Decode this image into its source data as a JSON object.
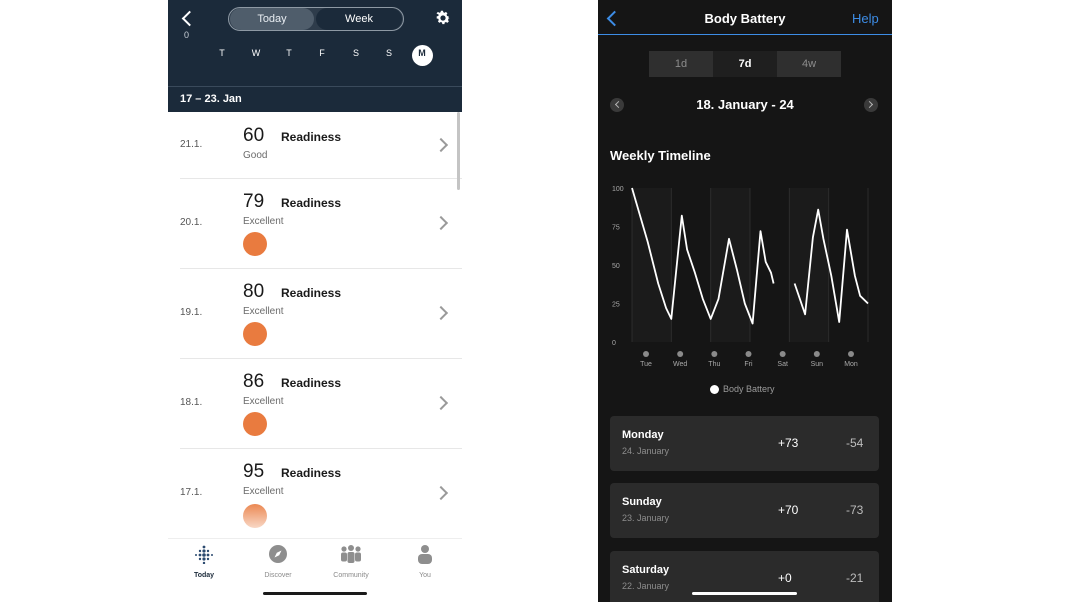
{
  "left": {
    "segments": {
      "today": "Today",
      "week": "Week"
    },
    "axis_zero": "0",
    "days": [
      "T",
      "W",
      "T",
      "F",
      "S",
      "S",
      "M"
    ],
    "range_label": "17 – 23. Jan",
    "rows": [
      {
        "date": "21.1.",
        "score": "60",
        "label": "Readiness",
        "status": "Good",
        "badge": false
      },
      {
        "date": "20.1.",
        "score": "79",
        "label": "Readiness",
        "status": "Excellent",
        "badge": true
      },
      {
        "date": "19.1.",
        "score": "80",
        "label": "Readiness",
        "status": "Excellent",
        "badge": true
      },
      {
        "date": "18.1.",
        "score": "86",
        "label": "Readiness",
        "status": "Excellent",
        "badge": true
      },
      {
        "date": "17.1.",
        "score": "95",
        "label": "Readiness",
        "status": "Excellent",
        "badge": true
      }
    ],
    "tabs": [
      {
        "label": "Today",
        "icon": "fitbit-dots-icon"
      },
      {
        "label": "Discover",
        "icon": "compass-icon"
      },
      {
        "label": "Community",
        "icon": "people-icon"
      },
      {
        "label": "You",
        "icon": "person-icon"
      }
    ],
    "colors": {
      "header": "#1b2a3a",
      "badge": "#e97b3f"
    }
  },
  "right": {
    "title": "Body Battery",
    "help": "Help",
    "segments": [
      "1d",
      "7d",
      "4w"
    ],
    "range": "18. January - 24",
    "section_title": "Weekly Timeline",
    "legend": "Body Battery",
    "cards": [
      {
        "day": "Monday",
        "date": "24. January",
        "plus": "+73",
        "minus": "-54"
      },
      {
        "day": "Sunday",
        "date": "23. January",
        "plus": "+70",
        "minus": "-73"
      },
      {
        "day": "Saturday",
        "date": "22. January",
        "plus": "+0",
        "minus": "-21"
      }
    ],
    "colors": {
      "accent": "#3d8de6",
      "background": "#151515",
      "card": "#2b2b2b"
    }
  },
  "chart_data": {
    "type": "line",
    "title": "Weekly Timeline",
    "x_categories": [
      "Tue",
      "Wed",
      "Thu",
      "Fri",
      "Sat",
      "Sun",
      "Mon"
    ],
    "ylim": [
      0,
      100
    ],
    "y_ticks": [
      "100",
      "75",
      "50",
      "25",
      "0"
    ],
    "grid": true,
    "legend": "bottom",
    "series": [
      {
        "name": "Body Battery",
        "points": [
          [
            0.0,
            100
          ],
          [
            0.6,
            65
          ],
          [
            1.0,
            38
          ],
          [
            1.3,
            22
          ],
          [
            1.5,
            15
          ],
          [
            1.9,
            82
          ],
          [
            2.1,
            60
          ],
          [
            2.4,
            45
          ],
          [
            2.7,
            28
          ],
          [
            3.0,
            15
          ],
          [
            3.3,
            28
          ],
          [
            3.7,
            67
          ],
          [
            4.0,
            47
          ],
          [
            4.3,
            25
          ],
          [
            4.6,
            12
          ],
          [
            4.9,
            72
          ],
          [
            5.1,
            52
          ],
          [
            5.3,
            45
          ],
          [
            5.4,
            38
          ],
          null,
          [
            6.2,
            38
          ],
          [
            6.6,
            18
          ],
          [
            6.9,
            68
          ],
          [
            7.1,
            86
          ],
          [
            7.3,
            67
          ],
          [
            7.6,
            43
          ],
          [
            7.9,
            13
          ],
          [
            8.2,
            73
          ],
          [
            8.5,
            43
          ],
          [
            8.7,
            30
          ],
          [
            9.0,
            25
          ]
        ]
      }
    ]
  }
}
